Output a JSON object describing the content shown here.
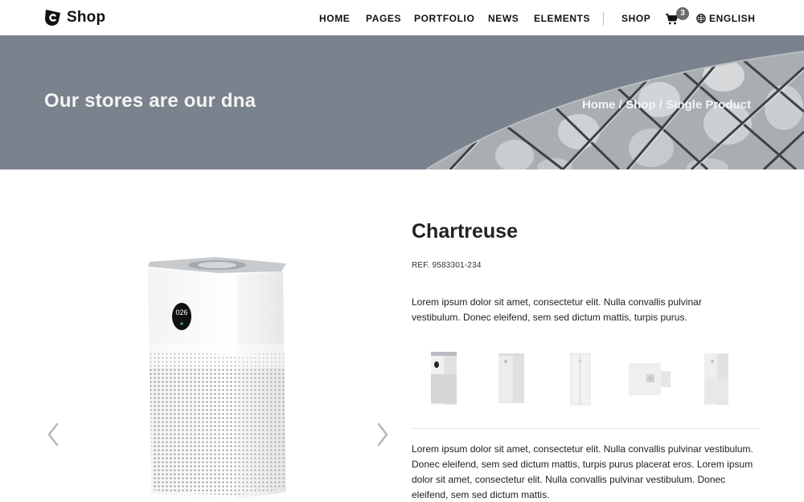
{
  "brand": {
    "name": "Shop"
  },
  "nav": {
    "home": "HOME",
    "pages": "PAGES",
    "portfolio": "PORTFOLIO",
    "news": "NEWS",
    "elements": "ELEMENTS",
    "shop": "SHOP",
    "cart_count": "3",
    "language": "ENGLISH"
  },
  "banner": {
    "title": "Our stores are our dna",
    "breadcrumb": {
      "home": "Home",
      "sep1": " / ",
      "shop": "Shop",
      "sep2": " / ",
      "current": "Single Product"
    }
  },
  "product": {
    "name": "Chartreuse",
    "ref": "REF. 9583301-234",
    "display_reading": "026",
    "short_description": "Lorem ipsum dolor sit amet, consectetur elit. Nulla convallis pulvinar vestibulum. Donec eleifend, sem sed dictum mattis, turpis purus.",
    "long_description": "Lorem ipsum dolor sit amet, consectetur elit. Nulla convallis pulvinar vestibulum. Donec eleifend, sem sed dictum mattis, turpis purus placerat eros. Lorem ipsum dolor sit amet, consectetur elit. Nulla convallis pulvinar vestibulum. Donec eleifend, sem sed dictum mattis."
  },
  "colors": {
    "banner_bg": "#7a828d",
    "text_dark": "#222222",
    "badge_bg": "#6b6b6b",
    "arrow": "#b5b5b5"
  },
  "icons": {
    "logo": "shop-logo-icon",
    "cart": "cart-icon",
    "language": "globe-icon",
    "prev": "chevron-left-icon",
    "next": "chevron-right-icon"
  }
}
